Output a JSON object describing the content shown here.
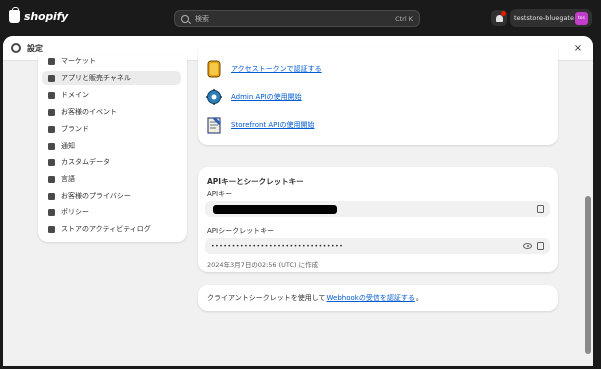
{
  "topbar": {
    "brand": "shopify",
    "search_placeholder": "検索",
    "search_shortcut": "Ctrl K",
    "store_name": "teststore-bluegate",
    "store_avatar_text": "tes"
  },
  "modal": {
    "title": "設定",
    "close_label": "×"
  },
  "sidebar": {
    "items": [
      {
        "label": "マーケット",
        "icon": "globe-icon"
      },
      {
        "label": "アプリと販売チャネル",
        "icon": "apps-icon",
        "active": true
      },
      {
        "label": "ドメイン",
        "icon": "domain-icon"
      },
      {
        "label": "お客様のイベント",
        "icon": "events-icon"
      },
      {
        "label": "ブランド",
        "icon": "brand-icon"
      },
      {
        "label": "通知",
        "icon": "bell-icon"
      },
      {
        "label": "カスタムデータ",
        "icon": "data-icon"
      },
      {
        "label": "言語",
        "icon": "language-icon"
      },
      {
        "label": "お客様のプライバシー",
        "icon": "privacy-icon"
      },
      {
        "label": "ポリシー",
        "icon": "policy-icon"
      },
      {
        "label": "ストアのアクティビティログ",
        "icon": "activity-icon"
      }
    ]
  },
  "api_links": {
    "access_token": "アクセストークンで認証する",
    "admin_api": "Admin APIの使用開始",
    "storefront_api": "Storefront APIの使用開始"
  },
  "api_credentials": {
    "title": "APIキーとシークレットキー",
    "api_key_label": "APIキー",
    "secret_label": "APIシークレットキー",
    "secret_masked": "••••••••••••••••••••••••••••••••",
    "created": "2024年3月7日の02:56 (UTC) に作成"
  },
  "webhook_note": {
    "prefix": "クライアントシークレットを使用して",
    "link": "Webhookの受信を認証する",
    "suffix": "。"
  },
  "colors": {
    "link": "#005bd3",
    "avatar": "#c23dc9",
    "notification_dot": "#e51c00"
  }
}
